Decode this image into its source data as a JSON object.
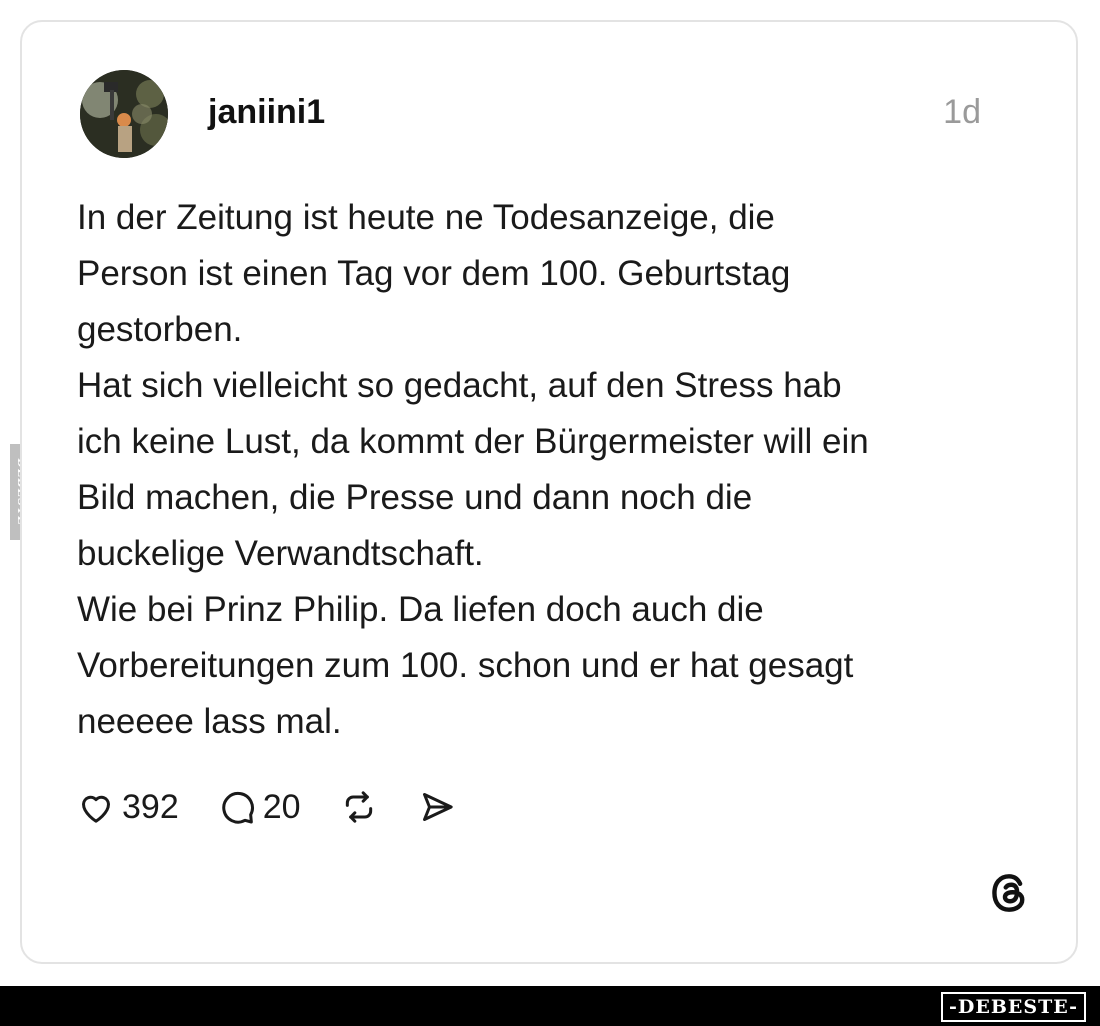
{
  "post": {
    "username": "janiini1",
    "timestamp": "1d",
    "text_lines": [
      "In der Zeitung ist heute ne Todesanzeige, die",
      "Person ist einen Tag vor dem 100. Geburtstag",
      "gestorben.",
      "Hat sich vielleicht so gedacht, auf den Stress hab",
      "ich keine Lust, da kommt der Bürgermeister will ein",
      "Bild machen, die Presse und dann noch die",
      "buckelige Verwandtschaft.",
      "Wie bei Prinz Philip. Da liefen doch auch die",
      "Vorbereitungen zum 100. schon und er hat gesagt",
      "neeeee lass mal."
    ],
    "likes": "392",
    "comments": "20"
  },
  "icons": {
    "like": "heart-icon",
    "comment": "speech-bubble-icon",
    "repost": "repost-icon",
    "share": "send-icon",
    "brand": "threads-logo-icon"
  },
  "watermarks": {
    "side": "DEBESTE",
    "bottom": "-DEBESTE-"
  },
  "colors": {
    "text": "#1a1a1a",
    "muted": "#9a9a9a",
    "border": "#e3e3e3"
  }
}
